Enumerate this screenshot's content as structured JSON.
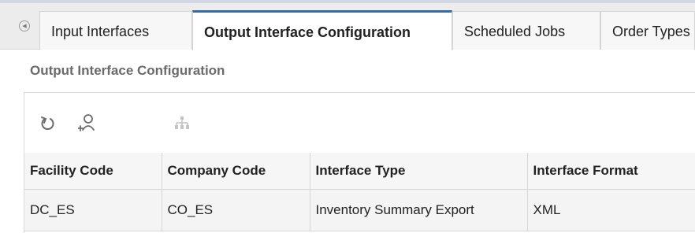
{
  "tabs": [
    {
      "label": "Input Interfaces",
      "active": false
    },
    {
      "label": "Output Interface Configuration",
      "active": true
    },
    {
      "label": "Scheduled Jobs",
      "active": false
    },
    {
      "label": "Order Types",
      "active": false
    }
  ],
  "section": {
    "title": "Output Interface Configuration"
  },
  "toolbar": {
    "icons": [
      "refresh-icon",
      "add-user-icon",
      "hierarchy-icon"
    ]
  },
  "table": {
    "columns": [
      "Facility Code",
      "Company Code",
      "Interface Type",
      "Interface Format"
    ],
    "rows": [
      [
        "DC_ES",
        "CO_ES",
        "Inventory Summary Export",
        "XML"
      ]
    ]
  },
  "colors": {
    "accent": "#1f6fbd",
    "tab_bar_bg": "#ececec",
    "row_bg": "#f4f4f4",
    "title_text": "#6a6a6a"
  }
}
